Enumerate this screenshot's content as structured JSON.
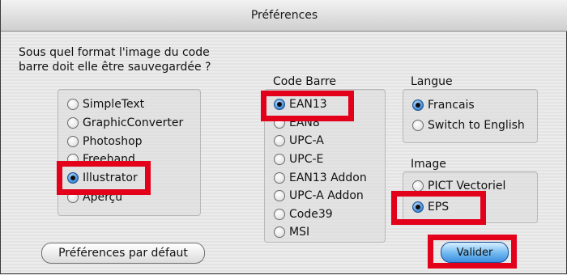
{
  "window": {
    "title": "Préférences"
  },
  "question": "Sous quel format l'image du code barre doit elle être sauvegardée ?",
  "apps": {
    "items": [
      {
        "label": "SimpleText",
        "selected": false
      },
      {
        "label": "GraphicConverter",
        "selected": false
      },
      {
        "label": "Photoshop",
        "selected": false
      },
      {
        "label": "Freehand",
        "selected": false
      },
      {
        "label": "Illustrator",
        "selected": true
      },
      {
        "label": "Aperçu",
        "selected": false
      }
    ]
  },
  "codebarre": {
    "label": "Code Barre",
    "items": [
      {
        "label": "EAN13",
        "selected": true
      },
      {
        "label": "EAN8",
        "selected": false
      },
      {
        "label": "UPC-A",
        "selected": false
      },
      {
        "label": "UPC-E",
        "selected": false
      },
      {
        "label": "EAN13 Addon",
        "selected": false
      },
      {
        "label": "UPC-A Addon",
        "selected": false
      },
      {
        "label": "Code39",
        "selected": false
      },
      {
        "label": "MSI",
        "selected": false
      }
    ]
  },
  "langue": {
    "label": "Langue",
    "items": [
      {
        "label": "Francais",
        "selected": true
      },
      {
        "label": "Switch to English",
        "selected": false
      }
    ]
  },
  "image": {
    "label": "Image",
    "items": [
      {
        "label": "PICT Vectoriel",
        "selected": false
      },
      {
        "label": "EPS",
        "selected": true
      }
    ]
  },
  "buttons": {
    "defaults_label": "Préférences par défaut",
    "validate_label": "Valider"
  },
  "colors": {
    "highlight": "#e3001b",
    "accent": "#3d8fe0"
  }
}
